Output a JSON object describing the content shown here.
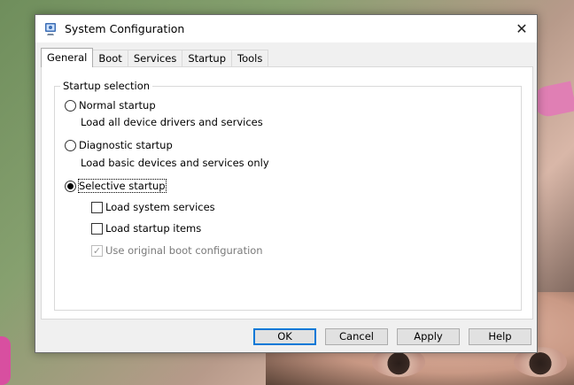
{
  "window": {
    "title": "System Configuration",
    "close_glyph": "✕",
    "icon": "msconfig-icon"
  },
  "tabs": [
    {
      "label": "General",
      "active": true
    },
    {
      "label": "Boot",
      "active": false
    },
    {
      "label": "Services",
      "active": false
    },
    {
      "label": "Startup",
      "active": false
    },
    {
      "label": "Tools",
      "active": false
    }
  ],
  "startup": {
    "group_label": "Startup selection",
    "normal": {
      "label": "Normal startup",
      "desc": "Load all device drivers and services",
      "selected": false
    },
    "diagnostic": {
      "label": "Diagnostic startup",
      "desc": "Load basic devices and services only",
      "selected": false
    },
    "selective": {
      "label": "Selective startup",
      "selected": true
    },
    "options": {
      "load_services": {
        "label": "Load system services",
        "checked": false
      },
      "load_startup": {
        "label": "Load startup items",
        "checked": false
      },
      "use_boot": {
        "label": "Use original boot configuration",
        "checked": true,
        "disabled": true
      }
    }
  },
  "buttons": {
    "ok": "OK",
    "cancel": "Cancel",
    "apply": "Apply",
    "help": "Help"
  },
  "colors": {
    "accent": "#0078d7",
    "face": "#f0f0f0"
  }
}
